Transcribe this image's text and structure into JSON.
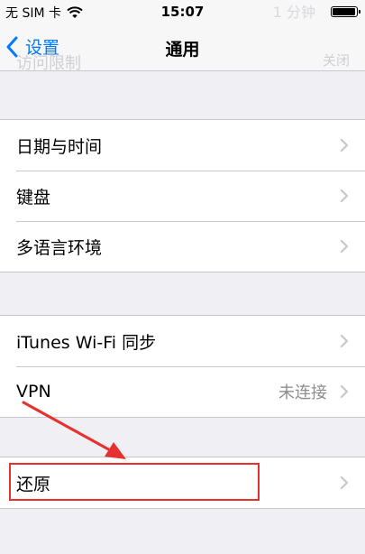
{
  "status_bar": {
    "carrier": "无 SIM 卡",
    "time": "15:07",
    "ghost_text": "1 分钟"
  },
  "nav_bar": {
    "back_label": "设置",
    "title": "通用",
    "ghost_label": "访问限制",
    "ghost_value": "关闭"
  },
  "groups": [
    {
      "rows": [
        {
          "label": "日期与时间"
        },
        {
          "label": "键盘"
        },
        {
          "label": "多语言环境"
        }
      ]
    },
    {
      "rows": [
        {
          "label": "iTunes Wi-Fi 同步"
        },
        {
          "label": "VPN",
          "value": "未连接"
        }
      ]
    },
    {
      "rows": [
        {
          "label": "还原"
        }
      ]
    }
  ],
  "colors": {
    "accent": "#007aff",
    "background": "#efeff4",
    "annotation": "#e5322f"
  }
}
